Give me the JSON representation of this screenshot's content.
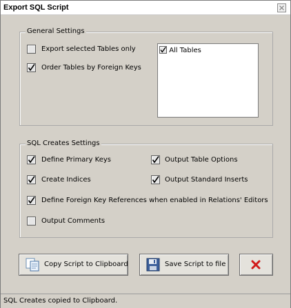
{
  "window": {
    "title": "Export SQL Script"
  },
  "general": {
    "label": "General Settings",
    "export_selected": {
      "label": "Export selected Tables only",
      "checked": false
    },
    "order_fk": {
      "label": "Order Tables by Foreign Keys",
      "checked": true
    },
    "table_list": [
      {
        "label": "All Tables",
        "checked": true
      }
    ]
  },
  "sql_creates": {
    "label": "SQL Creates Settings",
    "define_pk": {
      "label": "Define Primary Keys",
      "checked": true
    },
    "output_table_options": {
      "label": "Output Table Options",
      "checked": true
    },
    "create_indices": {
      "label": "Create Indices",
      "checked": true
    },
    "output_standard_inserts": {
      "label": "Output Standard Inserts",
      "checked": true
    },
    "define_fk": {
      "label": "Define Foreign Key References when enabled in Relations' Editors",
      "checked": true
    },
    "output_comments": {
      "label": "Output Comments",
      "checked": false
    }
  },
  "buttons": {
    "copy_clipboard": "Copy Script to Clipboard",
    "save_file": "Save Script to file",
    "close_icon": "red-x-icon"
  },
  "status": {
    "text": "SQL Creates copied to Clipboard."
  }
}
